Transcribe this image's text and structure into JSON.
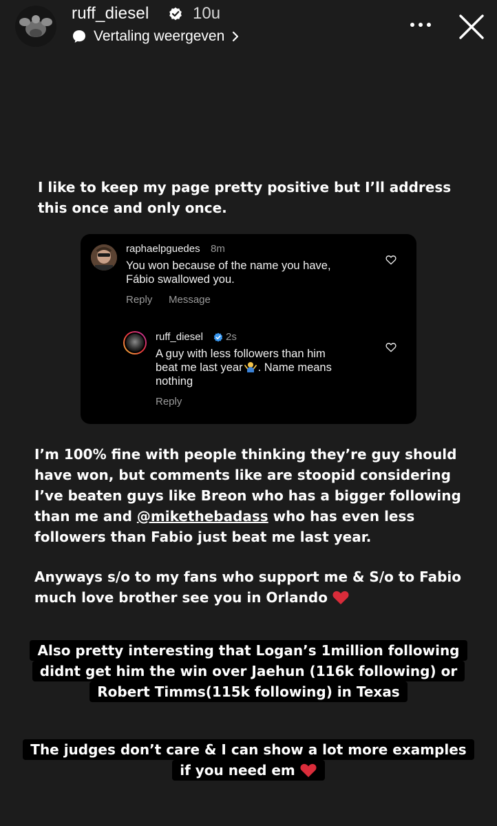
{
  "header": {
    "username": "ruff_diesel",
    "time_ago": "10u",
    "translate_label": "Vertaling weergeven"
  },
  "intro_text": "I like to keep my page pretty positive but I’ll address\nthis once and only once.",
  "comment_card": {
    "comment": {
      "username": "raphaelpguedes",
      "time": "8m",
      "text": "You won because of the name you have,\nFábio swallowed you.",
      "reply_label": "Reply",
      "message_label": "Message"
    },
    "reply": {
      "username": "ruff_diesel",
      "time": "2s",
      "text_before": "A guy with less followers than him\nbeat me last year",
      "text_after": ". Name means\nnothing",
      "reply_label": "Reply"
    }
  },
  "para2": {
    "before": "I’m 100% fine with people thinking they’re guy should\nhave won, but comments like are stoopid considering\nI’ve beaten guys like Breon who has a bigger following\nthan me and ",
    "mention": "@mikethebadass",
    "after": " who has even less\nfollowers than Fabio just beat me last year."
  },
  "para3": "Anyways s/o to my fans who support me & S/o to Fabio\nmuch love brother see you in Orlando",
  "highlight1": [
    "Also pretty interesting that Logan’s 1million following",
    "didnt get him the win over Jaehun (116k following) or",
    "Robert Timms(115k following) in Texas"
  ],
  "highlight2": [
    "The judges don’t care & I can show a lot more examples",
    "if you need em"
  ],
  "colors": {
    "background": "#1c1c1c",
    "verified": "#3897f0",
    "heart": "#d92c3a"
  }
}
